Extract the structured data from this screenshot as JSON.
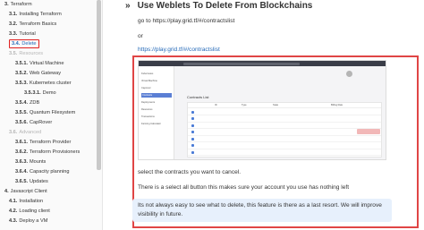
{
  "sidebar": {
    "items": [
      {
        "num": "3.",
        "label": "Terraform",
        "muted": false,
        "active": false,
        "indent": 5
      },
      {
        "num": "3.1.",
        "label": "Installing Terraform",
        "muted": false,
        "active": false,
        "indent": 10
      },
      {
        "num": "3.2.",
        "label": "Terraform Basics",
        "muted": false,
        "active": false,
        "indent": 10
      },
      {
        "num": "3.3.",
        "label": "Tutorial",
        "muted": false,
        "active": false,
        "indent": 10
      },
      {
        "num": "3.4.",
        "label": "Delete",
        "muted": false,
        "active": true,
        "indent": 10
      },
      {
        "num": "3.5.",
        "label": "Resources",
        "muted": true,
        "active": false,
        "indent": 10
      },
      {
        "num": "3.5.1.",
        "label": "Virtual Machine",
        "muted": false,
        "active": false,
        "indent": 17
      },
      {
        "num": "3.5.2.",
        "label": "Web Gateway",
        "muted": false,
        "active": false,
        "indent": 17
      },
      {
        "num": "3.5.3.",
        "label": "Kubernetes cluster",
        "muted": false,
        "active": false,
        "indent": 17
      },
      {
        "num": "3.5.3.1.",
        "label": "Demo",
        "muted": false,
        "active": false,
        "indent": 27
      },
      {
        "num": "3.5.4.",
        "label": "ZDB",
        "muted": false,
        "active": false,
        "indent": 17
      },
      {
        "num": "3.5.5.",
        "label": "Quantum Filesystem",
        "muted": false,
        "active": false,
        "indent": 17
      },
      {
        "num": "3.5.6.",
        "label": "CapRover",
        "muted": false,
        "active": false,
        "indent": 17
      },
      {
        "num": "3.6.",
        "label": "Advanced",
        "muted": true,
        "active": false,
        "indent": 10
      },
      {
        "num": "3.6.1.",
        "label": "Terraform Provider",
        "muted": false,
        "active": false,
        "indent": 17
      },
      {
        "num": "3.6.2.",
        "label": "Terraform Provisioners",
        "muted": false,
        "active": false,
        "indent": 17
      },
      {
        "num": "3.6.3.",
        "label": "Mounts",
        "muted": false,
        "active": false,
        "indent": 17
      },
      {
        "num": "3.6.4.",
        "label": "Capacity planning",
        "muted": false,
        "active": false,
        "indent": 17
      },
      {
        "num": "3.6.5.",
        "label": "Updates",
        "muted": false,
        "active": false,
        "indent": 17
      },
      {
        "num": "4.",
        "label": "Javascript Client",
        "muted": false,
        "active": false,
        "indent": 5
      },
      {
        "num": "4.1.",
        "label": "Installation",
        "muted": false,
        "active": false,
        "indent": 10
      },
      {
        "num": "4.2.",
        "label": "Loading client",
        "muted": false,
        "active": false,
        "indent": 10
      },
      {
        "num": "4.3.",
        "label": "Deploy a VM",
        "muted": false,
        "active": false,
        "indent": 10
      }
    ]
  },
  "main": {
    "title_mark": "»",
    "title": "Use Weblets To Delete From Blockchains",
    "go_to": "go to https://play.grid.tf/#/contractslist",
    "or": "or",
    "link": "https://play.grid.tf/#/contractslist",
    "select_text": "select the contracts you want to cancel.",
    "select_all_text": "There is a select all button this makes sure your account you use has nothing left",
    "note_line1": "Its not always easy to see what to delete, this feature is there as a last resort. We will improve",
    "note_line2": "visibility in future."
  },
  "embedded_screenshot": {
    "sidebar_items": [
      "Kubernetes",
      "Virtual Machine",
      "Caprover",
      "Contracts",
      "Deployments",
      "Resources",
      "Transactions",
      "Farming Calculator"
    ],
    "active_index": 3,
    "heading": "Contracts List",
    "table_headers": [
      "ID",
      "Type",
      "State",
      "Billing Rate"
    ],
    "rows": 7
  },
  "colors": {
    "accent": "#2469b8",
    "active_border": "#e02020",
    "screenshot_border": "#e04545",
    "note_bg": "#e7f0fc"
  }
}
